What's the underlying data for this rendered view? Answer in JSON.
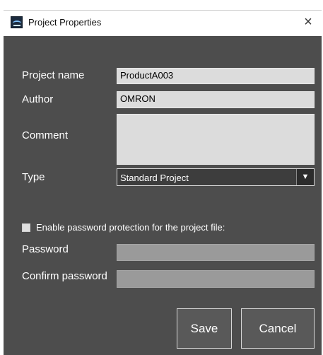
{
  "window": {
    "title": "Project Properties",
    "close_symbol": "×",
    "app_icon": "sysmac-studio-icon"
  },
  "form": {
    "project_name": {
      "label": "Project name",
      "value": "ProductA003"
    },
    "author": {
      "label": "Author",
      "value": "OMRON"
    },
    "comment": {
      "label": "Comment",
      "value": ""
    },
    "type": {
      "label": "Type",
      "value": "Standard Project",
      "arrow": "▼"
    },
    "password_protection": {
      "label": "Enable password protection for the project file:",
      "checked": false
    },
    "password": {
      "label": "Password",
      "value": ""
    },
    "confirm_password": {
      "label": "Confirm password",
      "value": ""
    }
  },
  "buttons": {
    "save": "Save",
    "cancel": "Cancel"
  },
  "colors": {
    "dialog_background": "#4d4d4d",
    "field_background": "#dcdcdc",
    "disabled_field": "#9a9a9a",
    "button_background": "#595959"
  }
}
